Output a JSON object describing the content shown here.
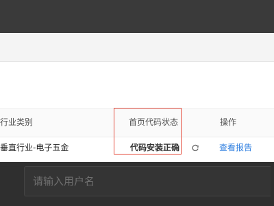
{
  "table": {
    "headers": {
      "industry": "行业类别",
      "home_code_status": "首页代码状态",
      "actions": "操作"
    },
    "rows": [
      {
        "industry": "垂直行业-电子五金",
        "home_code_status": "代码安装正确",
        "action_label": "查看报告"
      }
    ]
  },
  "login": {
    "username_placeholder": "请输入用户名"
  },
  "colors": {
    "link": "#2f7fe0",
    "highlight": "#e44a3a",
    "overlay": "#2f2f2f"
  },
  "icons": {
    "status_refresh": "refresh-icon"
  }
}
